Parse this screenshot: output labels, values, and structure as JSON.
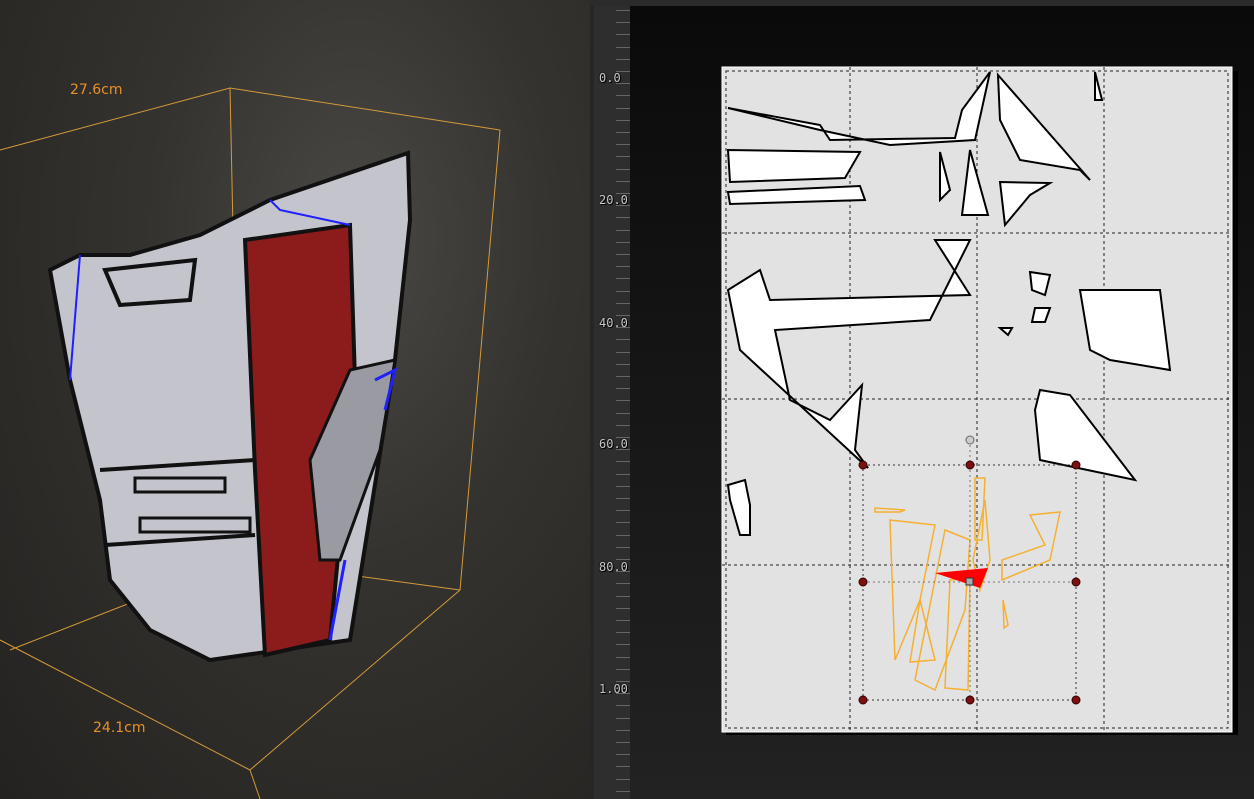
{
  "viewport_3d": {
    "height_dimension": "27.6cm",
    "width_dimension": "24.1cm",
    "colors": {
      "bbox": "#e8a030",
      "model_body": "#c4c4cc",
      "model_accent": "#8c1c1c",
      "seam": "#1a1aff"
    }
  },
  "uv_editor": {
    "ruler_labels": [
      "0.0",
      "20.0",
      "40.0",
      "60.0",
      "80.0",
      "1.00"
    ],
    "colors": {
      "sheet": "#e2e2e2",
      "selection": "#f5b030",
      "handle": "#7a1010",
      "pivot_triangle": "#ff0000"
    }
  }
}
